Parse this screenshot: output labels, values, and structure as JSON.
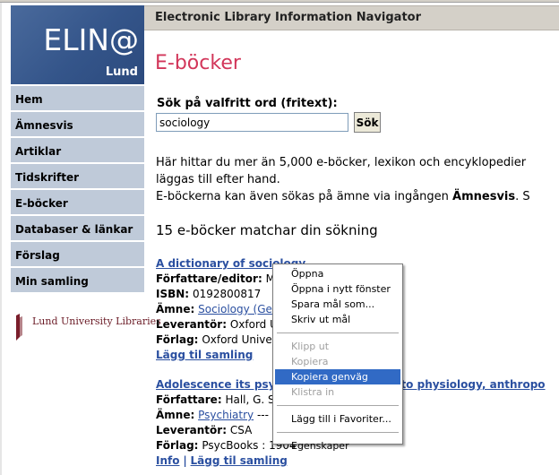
{
  "header": {
    "logo_word": "ELIN@",
    "logo_city": "Lund",
    "bar_title": "Electronic Library Information Navigator",
    "page_title": "E-böcker"
  },
  "sidebar": {
    "items": [
      {
        "label": "Hem"
      },
      {
        "label": "Ämnesvis"
      },
      {
        "label": "Artiklar"
      },
      {
        "label": "Tidskrifter"
      },
      {
        "label": "E-böcker"
      },
      {
        "label": "Databaser & länkar"
      },
      {
        "label": "Förslag"
      },
      {
        "label": "Min samling"
      }
    ],
    "library_name": "Lund University Libraries"
  },
  "search": {
    "label": "Sök på valfritt ord (fritext):",
    "value": "sociology",
    "button": "Sök"
  },
  "intro": {
    "line1": "Här hittar du mer än 5,000 e-böcker, lexikon och encyklopedier",
    "line2": "läggas till efter hand.",
    "line3_pre": "E-böckerna kan även sökas på ämne via ingången ",
    "line3_bold": "Ämnesvis",
    "line3_post": ". S"
  },
  "results": {
    "count_text": "15 e-böcker matchar din sökning",
    "entry1": {
      "title": "A dictionary of sociology",
      "author_label": "Författare/editor:",
      "author_value": "M",
      "isbn_label": "ISBN:",
      "isbn_value": "0192800817",
      "subject_label": "Ämne:",
      "subject_value": "Sociology (Ge",
      "vendor_label": "Leverantör:",
      "vendor_value": "Oxford U",
      "publisher_label": "Förlag:",
      "publisher_value": "Oxford Unive",
      "add_link": "Lägg til samling"
    },
    "entry2": {
      "title_pre": "Adolescence its psyc",
      "title_post": "ns to physiology, anthropo",
      "author_label": "Författare:",
      "author_value": "Hall, G. S",
      "subject_label": "Ämne:",
      "subject_value": "Psychiatry",
      "subject_rest": "---",
      "vendor_label": "Leverantör:",
      "vendor_value": "CSA",
      "publisher_label": "Förlag:",
      "publisher_value": "PsycBooks : 1904",
      "info_link": "Info",
      "divider": "|",
      "add_link": "Lägg til samling"
    }
  },
  "context_menu": {
    "open": "Öppna",
    "open_new_window": "Öppna i nytt fönster",
    "save_target_as": "Spara mål som...",
    "print_target": "Skriv ut mål",
    "cut": "Klipp ut",
    "copy": "Kopiera",
    "copy_shortcut": "Kopiera genväg",
    "paste": "Klistra in",
    "add_to_favorites": "Lägg till i Favoriter...",
    "properties": "Egenskaper"
  }
}
